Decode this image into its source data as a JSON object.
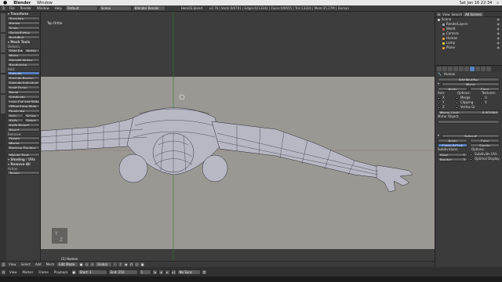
{
  "macbar": {
    "apple": "",
    "app": "Blender",
    "window": "Window",
    "time": "Sat Jan 16  22:34",
    "search": "⌕"
  },
  "info": {
    "menus": [
      "File",
      "Render",
      "Window",
      "Help"
    ],
    "layout": "Default",
    "scene": "Scene",
    "engine": "Blender Render",
    "file": "Hero03.blend",
    "stats": "v2.76 | Verts:0/6701 | Edges:0/13341 | Faces:0/6655 | Tris:13310 | Mem:35.27M | Human"
  },
  "toolshelf": {
    "sections": [
      {
        "head": "▾ Transform",
        "items": [
          "Translate",
          "Rotate",
          "Scale",
          "Shrink/Fatten",
          "Push/Pull"
        ]
      },
      {
        "head": "▾ Mesh Tools",
        "items": []
      },
      {
        "label": "Deform:",
        "items": [
          "Slide Edge",
          "Vertex",
          "Noise",
          "Smooth Vertex",
          "Randomize"
        ]
      },
      {
        "label": "Add:",
        "items": [
          "Extrude",
          "Extrude Region",
          "Extrude Individual",
          "Inset Faces",
          "Bevel",
          "Subdivide",
          "Loop Cut and Slide",
          "Offset Edge Slide",
          "Duplicate",
          "Spin",
          "Screw",
          "Knife",
          "Select",
          "Knife Project",
          "Bisect"
        ]
      },
      {
        "label": "Remove:",
        "items": [
          "Delete",
          "Merge",
          "Remove Doubles"
        ]
      },
      {
        "label": "",
        "items": [
          "Weight Tools"
        ]
      },
      {
        "head": "▾ Shading / UVs",
        "items": []
      }
    ],
    "operator_head": "▾ Remove All",
    "operator_label": "Action",
    "operator_value": "Toggle"
  },
  "viewport": {
    "view_name": "Top Ortho",
    "object_label": "(1) Human",
    "bg_color": "#9a9893",
    "mesh_color": "#b8b8c4"
  },
  "header3d": {
    "view": "View",
    "select": "Select",
    "add": "Add",
    "mesh": "Mesh",
    "mode": "Edit Mode",
    "pivot": "Global"
  },
  "timeline": {
    "view": "View",
    "marker": "Marker",
    "frame": "Frame",
    "playback": "Playback",
    "start": "Start:",
    "start_val": "1",
    "end": "End:",
    "end_val": "250",
    "current": "1",
    "sync": "No Sync"
  },
  "outliner": {
    "header_view": "View",
    "header_search": "Search",
    "header_scenes": "All Scenes",
    "items": [
      {
        "label": "Scene",
        "indent": 0,
        "color": "#c9c9c9"
      },
      {
        "label": "RenderLayers",
        "indent": 1,
        "color": "#9ab"
      },
      {
        "label": "World",
        "indent": 1,
        "color": "#c55"
      },
      {
        "label": "Camera",
        "indent": 1,
        "color": "#888"
      },
      {
        "label": "Human",
        "indent": 1,
        "color": "#e9a33a"
      },
      {
        "label": "Lamp",
        "indent": 1,
        "color": "#e9d33a"
      },
      {
        "label": "Plane",
        "indent": 1,
        "color": "#e9a33a"
      }
    ]
  },
  "properties": {
    "object": "Human",
    "add_modifier": "Add Modifier",
    "mirror_name": "Mirror",
    "apply": "Apply",
    "copy": "Copy",
    "axis": "Axis:",
    "options": "Options:",
    "textures": "Textures:",
    "x": "X",
    "y": "Y",
    "z": "Z",
    "merge": "Merge",
    "clipping": "Clipping",
    "vertex_groups": "Vertex Gr",
    "u": "U",
    "v": "V",
    "merge_limit": "Merge Limit:",
    "merge_limit_val": "0.001000",
    "mirror_object": "Mirror Object:",
    "subsurf_name": "Subsurf",
    "catmull": "Catmull-Clark",
    "simple": "Simple",
    "subdivisions": "Subdivisions:",
    "options2": "Options:",
    "view_lbl": "View:",
    "view_val": "1",
    "render_lbl": "Render:",
    "render_val": "2",
    "subdivide_uvs": "Subdivide UVs",
    "optimal_display": "Optimal Display"
  }
}
